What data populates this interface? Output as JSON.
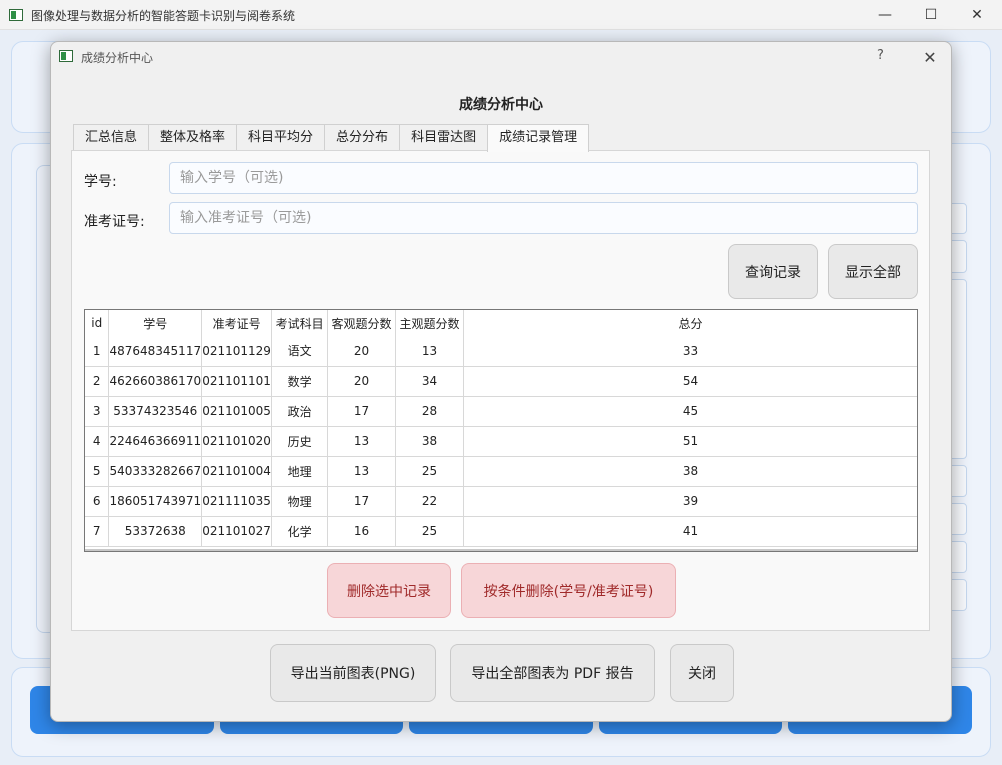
{
  "main_window": {
    "title": "图像处理与数据分析的智能答题卡识别与阅卷系统",
    "controls": {
      "minimize": "—",
      "maximize": "☐",
      "close": "✕"
    }
  },
  "dialog": {
    "title": "成绩分析中心",
    "help": "?",
    "close": "✕",
    "heading": "成绩分析中心",
    "tabs": [
      {
        "label": "汇总信息"
      },
      {
        "label": "整体及格率"
      },
      {
        "label": "科目平均分"
      },
      {
        "label": "总分分布"
      },
      {
        "label": "科目雷达图"
      },
      {
        "label": "成绩记录管理"
      }
    ],
    "active_tab": "成绩记录管理",
    "form": {
      "student_id_label": "学号:",
      "student_id_placeholder": "输入学号（可选)",
      "student_id_value": "",
      "exam_no_label": "准考证号:",
      "exam_no_placeholder": "输入准考证号（可选)",
      "exam_no_value": ""
    },
    "buttons": {
      "query": "查询记录",
      "show_all": "显示全部",
      "delete_selected": "删除选中记录",
      "delete_by_condition": "按条件删除(学号/准考证号)",
      "export_png": "导出当前图表(PNG)",
      "export_pdf": "导出全部图表为 PDF 报告",
      "close": "关闭"
    },
    "table": {
      "headers": [
        "id",
        "学号",
        "准考证号",
        "考试科目",
        "客观题分数",
        "主观题分数",
        "总分"
      ],
      "rows": [
        [
          "1",
          "487648345117",
          "021101129",
          "语文",
          "20",
          "13",
          "33"
        ],
        [
          "2",
          "462660386170",
          "021101101",
          "数学",
          "20",
          "34",
          "54"
        ],
        [
          "3",
          "53374323546",
          "021101005",
          "政治",
          "17",
          "28",
          "45"
        ],
        [
          "4",
          "224646366911",
          "021101020",
          "历史",
          "13",
          "38",
          "51"
        ],
        [
          "5",
          "540333282667",
          "021101004",
          "地理",
          "13",
          "25",
          "38"
        ],
        [
          "6",
          "186051743971",
          "021111035",
          "物理",
          "17",
          "22",
          "39"
        ],
        [
          "7",
          "53372638",
          "021101027",
          "化学",
          "16",
          "25",
          "41"
        ]
      ]
    }
  },
  "colors": {
    "accent_blue": "#2f86e8",
    "danger_bg": "#f7d6d8",
    "danger_text": "#a02a2a"
  }
}
